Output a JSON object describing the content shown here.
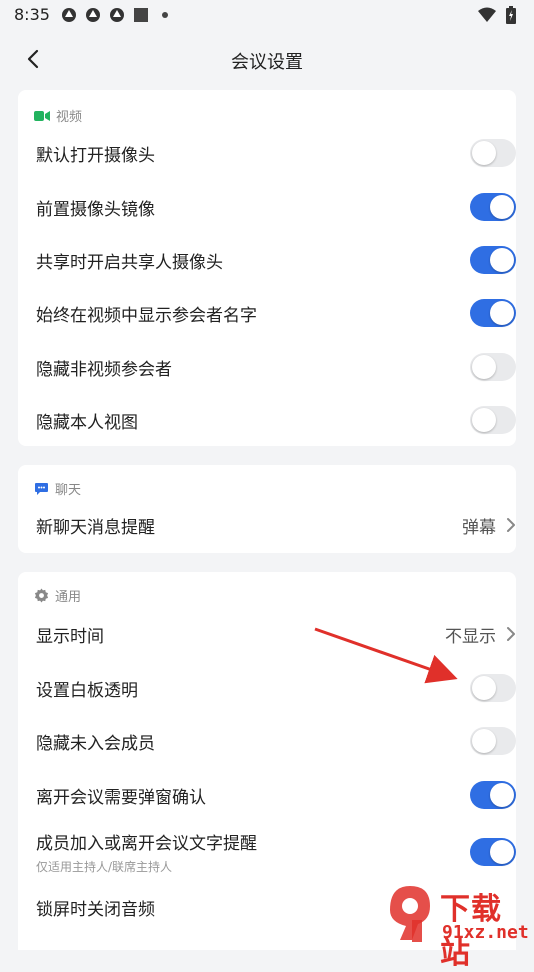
{
  "status": {
    "time": "8:35"
  },
  "header": {
    "title": "会议设置"
  },
  "video": {
    "section": "视频",
    "items": [
      {
        "label": "默认打开摄像头",
        "on": false
      },
      {
        "label": "前置摄像头镜像",
        "on": true
      },
      {
        "label": "共享时开启共享人摄像头",
        "on": true
      },
      {
        "label": "始终在视频中显示参会者名字",
        "on": true
      },
      {
        "label": "隐藏非视频参会者",
        "on": false
      },
      {
        "label": "隐藏本人视图",
        "on": false
      }
    ]
  },
  "chat": {
    "section": "聊天",
    "item": {
      "label": "新聊天消息提醒",
      "value": "弹幕"
    }
  },
  "general": {
    "section": "通用",
    "display_time": {
      "label": "显示时间",
      "value": "不显示"
    },
    "items": [
      {
        "label": "设置白板透明",
        "on": false
      },
      {
        "label": "隐藏未入会成员",
        "on": false
      },
      {
        "label": "离开会议需要弹窗确认",
        "on": true
      },
      {
        "label": "成员加入或离开会议文字提醒",
        "sub": "仅适用主持人/联席主持人",
        "on": true
      },
      {
        "label": "锁屏时关闭音频"
      }
    ]
  },
  "colors": {
    "accent": "#2f6ee3",
    "video_icon": "#22b35e",
    "chat_icon": "#2f6ee3",
    "arrow": "#e0302a"
  },
  "watermark": {
    "text1": "下载站",
    "text2": "91xz.net"
  }
}
